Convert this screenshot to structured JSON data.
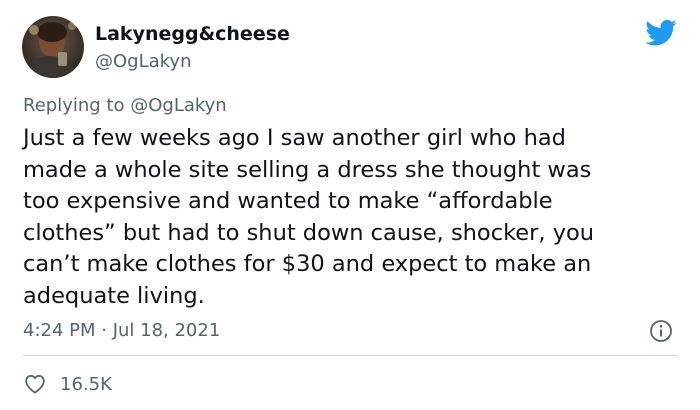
{
  "tweet": {
    "author": {
      "display_name": "Lakynegg&cheese",
      "handle": "@OgLakyn"
    },
    "reply_context": {
      "prefix": "Replying to",
      "mention": "@OgLakyn"
    },
    "text_lines": [
      "Just a few weeks ago I saw another girl who had",
      "made a whole site selling a dress she thought was",
      "too expensive and wanted to make “affordable",
      "clothes” but had to shut down cause, shocker, you",
      "can’t make clothes for $30 and expect to make an",
      "adequate living."
    ],
    "timestamp": "4:24 PM · Jul 18, 2021",
    "likes": "16.5K"
  },
  "icons": {
    "brand": "twitter-bird-icon",
    "info": "info-icon",
    "like": "heart-icon"
  },
  "colors": {
    "brand_blue": "#1d9bf0",
    "text_primary": "#0f1419",
    "text_secondary": "#536471",
    "divider": "#cfd9de"
  }
}
